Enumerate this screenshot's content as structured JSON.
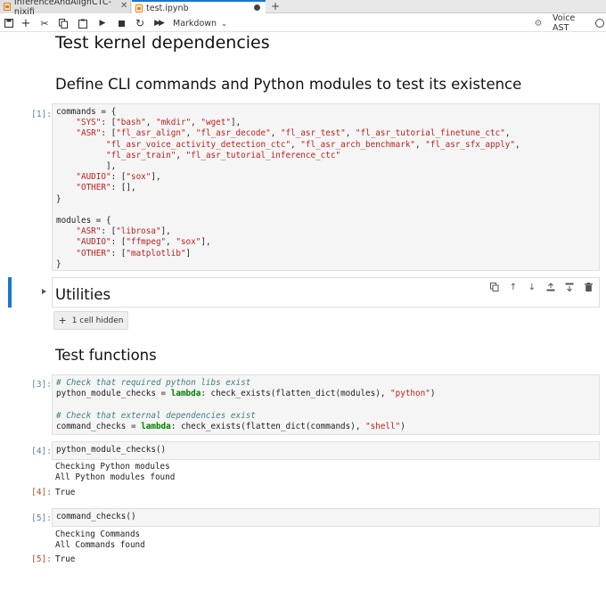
{
  "tabs": [
    {
      "label": "InferenceAndAlignCTC-nixifi",
      "active": false
    },
    {
      "label": "test.ipynb",
      "active": true
    }
  ],
  "toolbar": {
    "icons": [
      "save-icon",
      "add-cell-icon",
      "cut-icon",
      "copy-icon",
      "paste-icon",
      "run-icon",
      "stop-icon",
      "restart-icon",
      "restart-run-all-icon"
    ],
    "cell_type": "Markdown",
    "kernel_name": "Voice AST"
  },
  "notebook": {
    "title": "Test kernel dependencies",
    "section1_heading": "Define CLI commands and Python modules to test its existence",
    "cell1_prompt": "[1]:",
    "cell1_code": [
      "commands = {",
      "    \"SYS\": [\"bash\", \"mkdir\", \"wget\"],",
      "    \"ASR\": [\"fl_asr_align\", \"fl_asr_decode\", \"fl_asr_test\", \"fl_asr_tutorial_finetune_ctc\",",
      "          \"fl_asr_voice_activity_detection_ctc\", \"fl_asr_arch_benchmark\", \"fl_asr_sfx_apply\",",
      "          \"fl_asr_train\", \"fl_asr_tutorial_inference_ctc\"",
      "          ],",
      "    \"AUDIO\": [\"sox\"],",
      "    \"OTHER\": [],",
      "}",
      "",
      "modules = {",
      "    \"ASR\": [\"librosa\"],",
      "    \"AUDIO\": [\"ffmpeg\", \"sox\"],",
      "    \"OTHER\": [\"matplotlib\"]",
      "}"
    ],
    "utilities_heading": "Utilities",
    "hidden_cells_label": "1 cell hidden",
    "section2_heading": "Test functions",
    "cell3_prompt": "[3]:",
    "cell3_comment1": "# Check that required python libs exist",
    "cell3_line1_a": "python_module_checks = ",
    "cell3_line1_kw": "lambda",
    "cell3_line1_b": ": check_exists(flatten_dict(modules), ",
    "cell3_line1_str": "\"python\"",
    "cell3_line1_c": ")",
    "cell3_comment2": "# Check that external dependencies exist",
    "cell3_line2_a": "command_checks = ",
    "cell3_line2_kw": "lambda",
    "cell3_line2_b": ": check_exists(flatten_dict(commands), ",
    "cell3_line2_str": "\"shell\"",
    "cell3_line2_c": ")",
    "cell4_prompt": "[4]:",
    "cell4_code": "python_module_checks()",
    "cell4_stdout": [
      "Checking Python modules",
      "All Python modules found"
    ],
    "cell4_out_prompt": "[4]:",
    "cell4_result": "True",
    "cell5_prompt": "[5]:",
    "cell5_code": "command_checks()",
    "cell5_stdout": [
      "Checking Commands",
      "All Commands found"
    ],
    "cell5_out_prompt": "[5]:",
    "cell5_result": "True"
  },
  "colors": {
    "accent": "#1976d2",
    "string": "#ba2121",
    "comment": "#408080",
    "keyword": "#008000"
  }
}
